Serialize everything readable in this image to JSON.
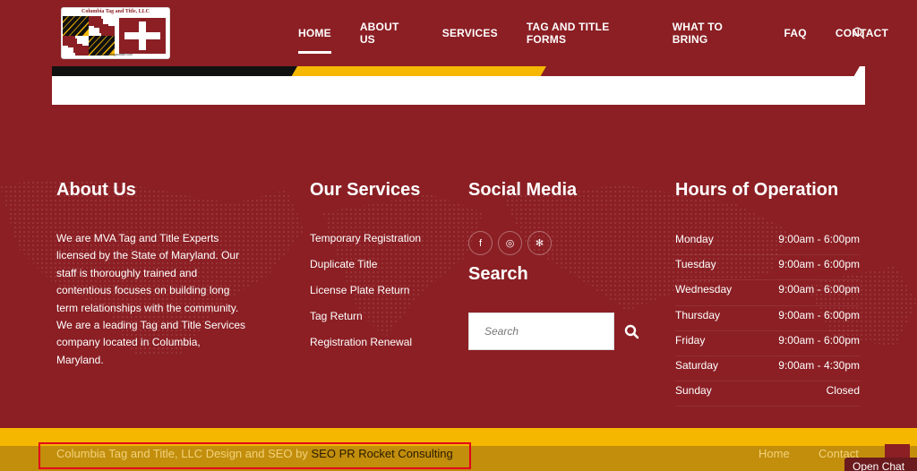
{
  "logo": {
    "title": "Columbia Tag and Title, LLC",
    "url": "columbiatagandtitle.com"
  },
  "nav": {
    "items": [
      "HOME",
      "ABOUT US",
      "SERVICES",
      "TAG AND TITLE FORMS",
      "WHAT TO BRING",
      "FAQ",
      "CONTACT"
    ],
    "active": "HOME"
  },
  "about": {
    "title_light": "About",
    "title_bold": "Us",
    "text": "We are MVA Tag and Title Experts licensed by the State of Maryland. Our staff is thoroughly trained and contentious focuses on building long term relationships with the community. We are a leading Tag and Title Services company located in Columbia, Maryland."
  },
  "services": {
    "title_light": "Our",
    "title_bold": "Services",
    "items": [
      "Temporary Registration",
      "Duplicate Title",
      "License Plate Return",
      "Tag Return",
      "Registration Renewal"
    ]
  },
  "social": {
    "title_light": "Social",
    "title_bold": "Media",
    "icons": [
      {
        "name": "facebook-icon",
        "glyph": "f"
      },
      {
        "name": "instagram-icon",
        "glyph": "◎"
      },
      {
        "name": "yelp-icon",
        "glyph": "✻"
      }
    ]
  },
  "search": {
    "title": "Search",
    "placeholder": "Search"
  },
  "hours": {
    "title_light": "Hours of",
    "title_bold": "Operation",
    "rows": [
      {
        "day": "Monday",
        "time": "9:00am - 6:00pm"
      },
      {
        "day": "Tuesday",
        "time": "9:00am - 6:00pm"
      },
      {
        "day": "Wednesday",
        "time": "9:00am - 6:00pm"
      },
      {
        "day": "Thursday",
        "time": "9:00am - 6:00pm"
      },
      {
        "day": "Friday",
        "time": "9:00am - 6:00pm"
      },
      {
        "day": "Saturday",
        "time": "9:00am - 4:30pm"
      },
      {
        "day": "Sunday",
        "time": "Closed"
      }
    ]
  },
  "footer_bottom": {
    "credit_prefix": "Columbia Tag and Title, LLC Design and SEO by",
    "credit_link": "SEO PR Rocket Consulting",
    "links": [
      "Home",
      "Contact"
    ],
    "chat_label": "Open Chat"
  },
  "colors": {
    "brand_red": "#8b1f24",
    "gold": "#f5b700",
    "highlight_box": "#e3001b"
  }
}
